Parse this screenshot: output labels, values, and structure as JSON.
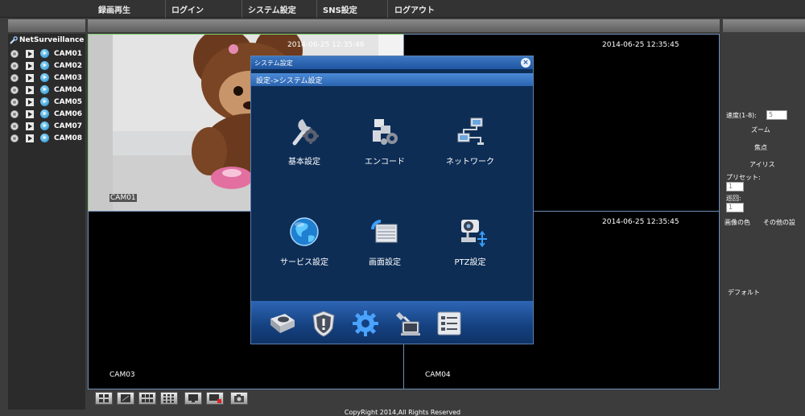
{
  "nav": {
    "items": [
      "録画再生",
      "ログイン",
      "システム設定",
      "SNS設定",
      "ログアウト"
    ]
  },
  "sidebar": {
    "brand": "NetSurveillance",
    "cameras": [
      "CAM01",
      "CAM02",
      "CAM03",
      "CAM04",
      "CAM05",
      "CAM06",
      "CAM07",
      "CAM08"
    ]
  },
  "grid": {
    "panes": [
      {
        "timestamp": "2014-06-25 12:35:46",
        "camera": "CAM01"
      },
      {
        "timestamp": "2014-06-25 12:35:45",
        "camera": ""
      },
      {
        "timestamp": "",
        "camera": "CAM03"
      },
      {
        "timestamp": "2014-06-25 12:35:45",
        "camera": "CAM04"
      }
    ]
  },
  "ptz": {
    "speed_label": "速度(1-8):",
    "speed_value": "5",
    "zoom": "ズーム",
    "focus": "焦点",
    "iris": "アイリス",
    "preset_label": "プリセット:",
    "preset_value": "1",
    "tour_label": "巡回:",
    "tour_value": "1",
    "image_color": "画像の色",
    "other_settings": "その他の設",
    "default": "デフォルト"
  },
  "dialog": {
    "title": "システム設定",
    "breadcrumb": "設定->システム設定",
    "tiles": {
      "basic": "基本設定",
      "encode": "エンコード",
      "network": "ネットワーク",
      "service": "サービス設定",
      "screen": "画面設定",
      "ptz": "PTZ設定"
    }
  },
  "footer": {
    "copyright": "CopyRight 2014,All Rights Reserved"
  },
  "colors": {
    "active_pane_border": "#7ccf6a",
    "pane_border": "#6e8fb8",
    "dialog_bg": "#0d2d55",
    "dialog_title": "#2b64b0"
  }
}
